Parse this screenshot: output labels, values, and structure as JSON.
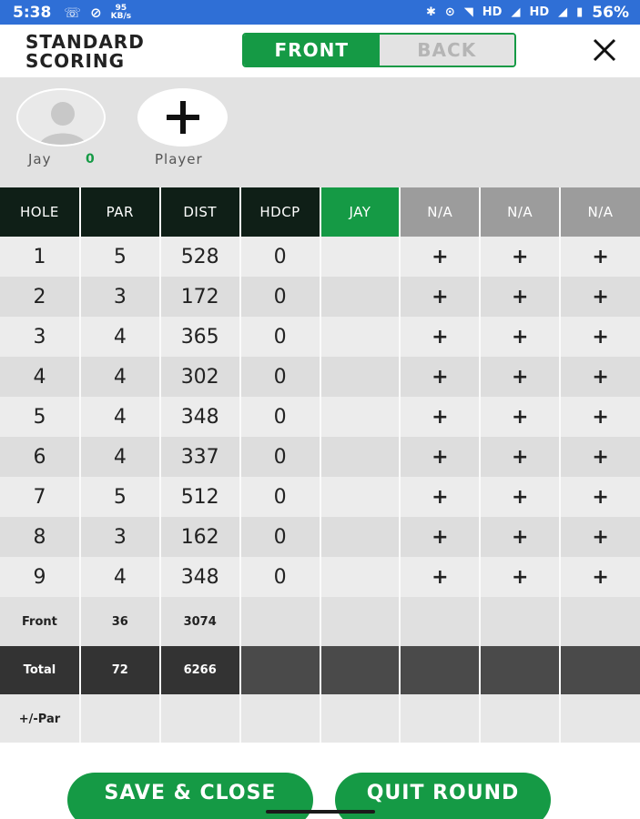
{
  "status_bar": {
    "time": "5:38",
    "net_speed_value": "95",
    "net_speed_unit": "KB/s",
    "hd1": "HD",
    "hd2": "HD",
    "battery": "56%",
    "color": "#2f6fd6"
  },
  "header": {
    "title_line1": "STANDARD",
    "title_line2": "SCORING",
    "toggle_front": "FRONT",
    "toggle_back": "BACK",
    "close_icon": "close-icon"
  },
  "players": [
    {
      "name": "Jay",
      "score": "0"
    },
    {
      "name": "Player"
    }
  ],
  "table": {
    "headers": [
      "HOLE",
      "PAR",
      "DIST",
      "HDCP",
      "JAY",
      "N/A",
      "N/A",
      "N/A"
    ],
    "rows": [
      {
        "hole": "1",
        "par": "5",
        "dist": "528",
        "hdcp": "0"
      },
      {
        "hole": "2",
        "par": "3",
        "dist": "172",
        "hdcp": "0"
      },
      {
        "hole": "3",
        "par": "4",
        "dist": "365",
        "hdcp": "0"
      },
      {
        "hole": "4",
        "par": "4",
        "dist": "302",
        "hdcp": "0"
      },
      {
        "hole": "5",
        "par": "4",
        "dist": "348",
        "hdcp": "0"
      },
      {
        "hole": "6",
        "par": "4",
        "dist": "337",
        "hdcp": "0"
      },
      {
        "hole": "7",
        "par": "5",
        "dist": "512",
        "hdcp": "0"
      },
      {
        "hole": "8",
        "par": "3",
        "dist": "162",
        "hdcp": "0"
      },
      {
        "hole": "9",
        "par": "4",
        "dist": "348",
        "hdcp": "0"
      }
    ],
    "add_symbol": "+",
    "front": {
      "label": "Front",
      "par": "36",
      "dist": "3074"
    },
    "total": {
      "label": "Total",
      "par": "72",
      "dist": "6266"
    },
    "plus_minus": {
      "label": "+/-Par"
    }
  },
  "footer": {
    "save_label": "SAVE & CLOSE",
    "quit_label": "QUIT ROUND"
  },
  "colors": {
    "accent": "#159a45",
    "header_dark": "#0f1f17",
    "na_header": "#9c9c9c"
  }
}
